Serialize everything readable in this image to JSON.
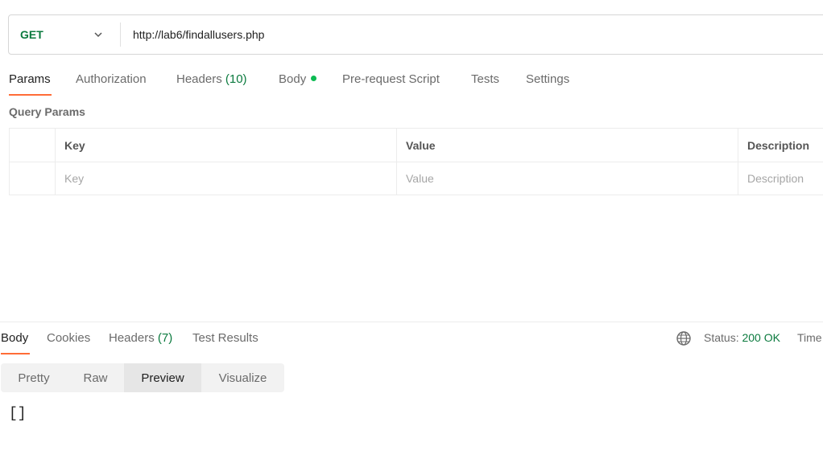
{
  "request": {
    "method": "GET",
    "url": "http://lab6/findallusers.php"
  },
  "request_tabs": {
    "params": "Params",
    "authorization": "Authorization",
    "headers": "Headers",
    "headers_count": "(10)",
    "body": "Body",
    "pre_request": "Pre-request Script",
    "tests": "Tests",
    "settings": "Settings"
  },
  "query_params": {
    "title": "Query Params",
    "columns": [
      "Key",
      "Value",
      "Description"
    ],
    "placeholders": {
      "key": "Key",
      "value": "Value",
      "description": "Description"
    }
  },
  "response_tabs": {
    "body": "Body",
    "cookies": "Cookies",
    "headers": "Headers",
    "headers_count": "(7)",
    "test_results": "Test Results"
  },
  "response_meta": {
    "status_label": "Status:",
    "status_value": "200 OK",
    "time_label": "Time"
  },
  "view_modes": [
    "Pretty",
    "Raw",
    "Preview",
    "Visualize"
  ],
  "response_body": "[]",
  "colors": {
    "accent": "#ff6c37",
    "method_green": "#0b7a3e",
    "dot_green": "#0cbb52"
  }
}
